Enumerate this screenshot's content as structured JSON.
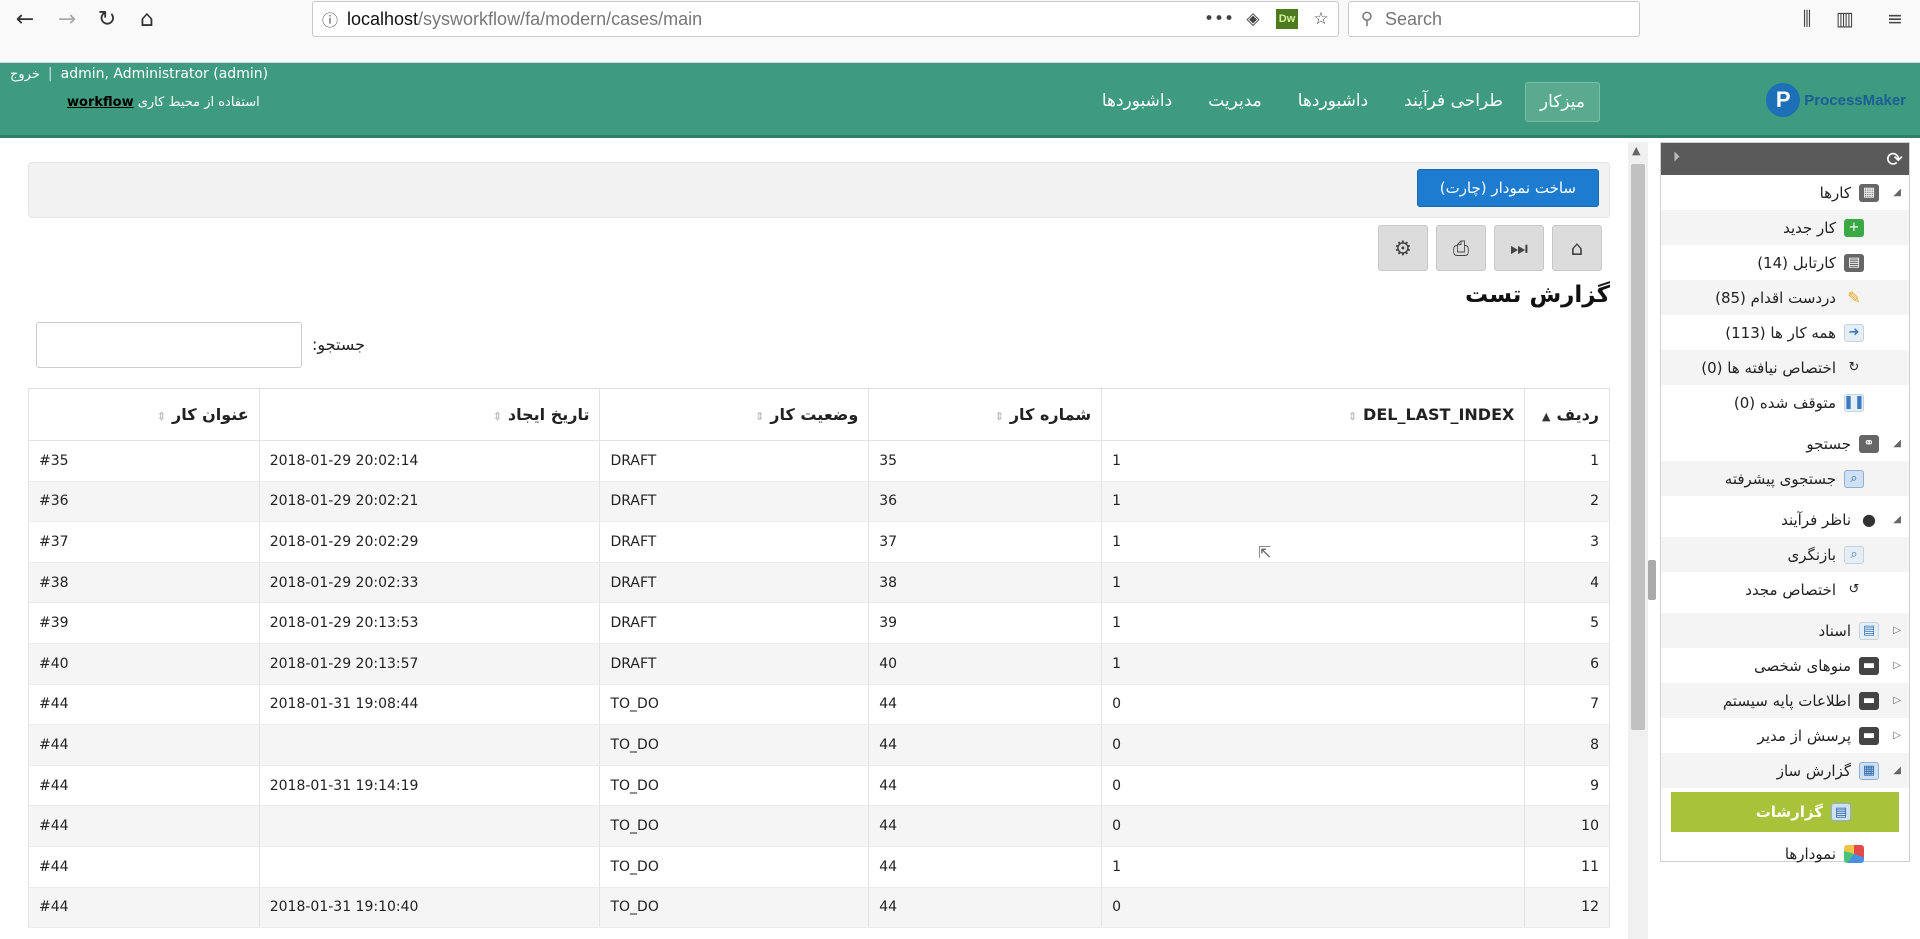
{
  "browser": {
    "url_host": "localhost",
    "url_path": "/sysworkflow/fa/modern/cases/main",
    "search_placeholder": "Search",
    "dw_badge": "Dw",
    "icons": [
      "back-icon",
      "forward-icon",
      "reload-icon",
      "home-icon",
      "info-icon",
      "more-icon",
      "pocket-icon",
      "star-icon",
      "library-icon",
      "sidebar-icon",
      "menu-icon"
    ]
  },
  "header": {
    "logout": "خروج",
    "user": "admin, Administrator (admin)",
    "workspace_prefix": "استفاده از محیط کاری",
    "workspace_name": "workflow",
    "logo_text": "ProcessMaker",
    "menu": [
      {
        "label": "میزکار",
        "active": true
      },
      {
        "label": "طراحی فرآیند",
        "active": false
      },
      {
        "label": "داشبوردها",
        "active": false
      },
      {
        "label": "مدیریت",
        "active": false
      },
      {
        "label": "داشبوردها",
        "active": false
      }
    ]
  },
  "sidebar": {
    "items": [
      {
        "label": "کارها",
        "type": "group"
      },
      {
        "label": "کار جدید",
        "type": "item"
      },
      {
        "label": "کارتابل (14)",
        "type": "item"
      },
      {
        "label": "دردست اقدام (85)",
        "type": "item"
      },
      {
        "label": "همه کار ها (113)",
        "type": "item"
      },
      {
        "label": "اختصاص نیافته ها (0)",
        "type": "item"
      },
      {
        "label": "متوقف شده (0)",
        "type": "item"
      },
      {
        "label": "جستجو",
        "type": "group"
      },
      {
        "label": "جستجوی پیشرفته",
        "type": "item"
      },
      {
        "label": "ناظر فرآیند",
        "type": "group"
      },
      {
        "label": "بازنگری",
        "type": "item"
      },
      {
        "label": "اختصاص مجدد",
        "type": "item"
      },
      {
        "label": "اسناد",
        "type": "group"
      },
      {
        "label": "منوهای شخصی",
        "type": "group"
      },
      {
        "label": "اطلاعات پایه سیستم",
        "type": "group"
      },
      {
        "label": "پرسش از مدیر",
        "type": "group"
      },
      {
        "label": "گزارش ساز",
        "type": "group"
      },
      {
        "label": "گزارشات",
        "type": "active"
      },
      {
        "label": "نمودارها",
        "type": "item"
      }
    ]
  },
  "report": {
    "chart_button": "ساخت نمودار (چارت)",
    "title": "گزارش تست",
    "search_label": "جستجو:",
    "columns": [
      "ردیف",
      "DEL_LAST_INDEX",
      "شماره کار",
      "وضعیت کار",
      "تاریخ ایجاد",
      "عنوان کار"
    ],
    "rows": [
      [
        "1",
        "1",
        "35",
        "DRAFT",
        "2018-01-29 20:02:14",
        "#35"
      ],
      [
        "2",
        "1",
        "36",
        "DRAFT",
        "2018-01-29 20:02:21",
        "#36"
      ],
      [
        "3",
        "1",
        "37",
        "DRAFT",
        "2018-01-29 20:02:29",
        "#37"
      ],
      [
        "4",
        "1",
        "38",
        "DRAFT",
        "2018-01-29 20:02:33",
        "#38"
      ],
      [
        "5",
        "1",
        "39",
        "DRAFT",
        "2018-01-29 20:13:53",
        "#39"
      ],
      [
        "6",
        "1",
        "40",
        "DRAFT",
        "2018-01-29 20:13:57",
        "#40"
      ],
      [
        "7",
        "0",
        "44",
        "TO_DO",
        "2018-01-31 19:08:44",
        "#44"
      ],
      [
        "8",
        "0",
        "44",
        "TO_DO",
        "",
        "#44"
      ],
      [
        "9",
        "0",
        "44",
        "TO_DO",
        "2018-01-31 19:14:19",
        "#44"
      ],
      [
        "10",
        "0",
        "44",
        "TO_DO",
        "",
        "#44"
      ],
      [
        "11",
        "1",
        "44",
        "TO_DO",
        "",
        "#44"
      ],
      [
        "12",
        "0",
        "44",
        "TO_DO",
        "2018-01-31 19:10:40",
        "#44"
      ]
    ]
  },
  "colors": {
    "header": "#3f9b7f",
    "accent": "#1d7bd0",
    "active_menu": "#a8c33a"
  }
}
